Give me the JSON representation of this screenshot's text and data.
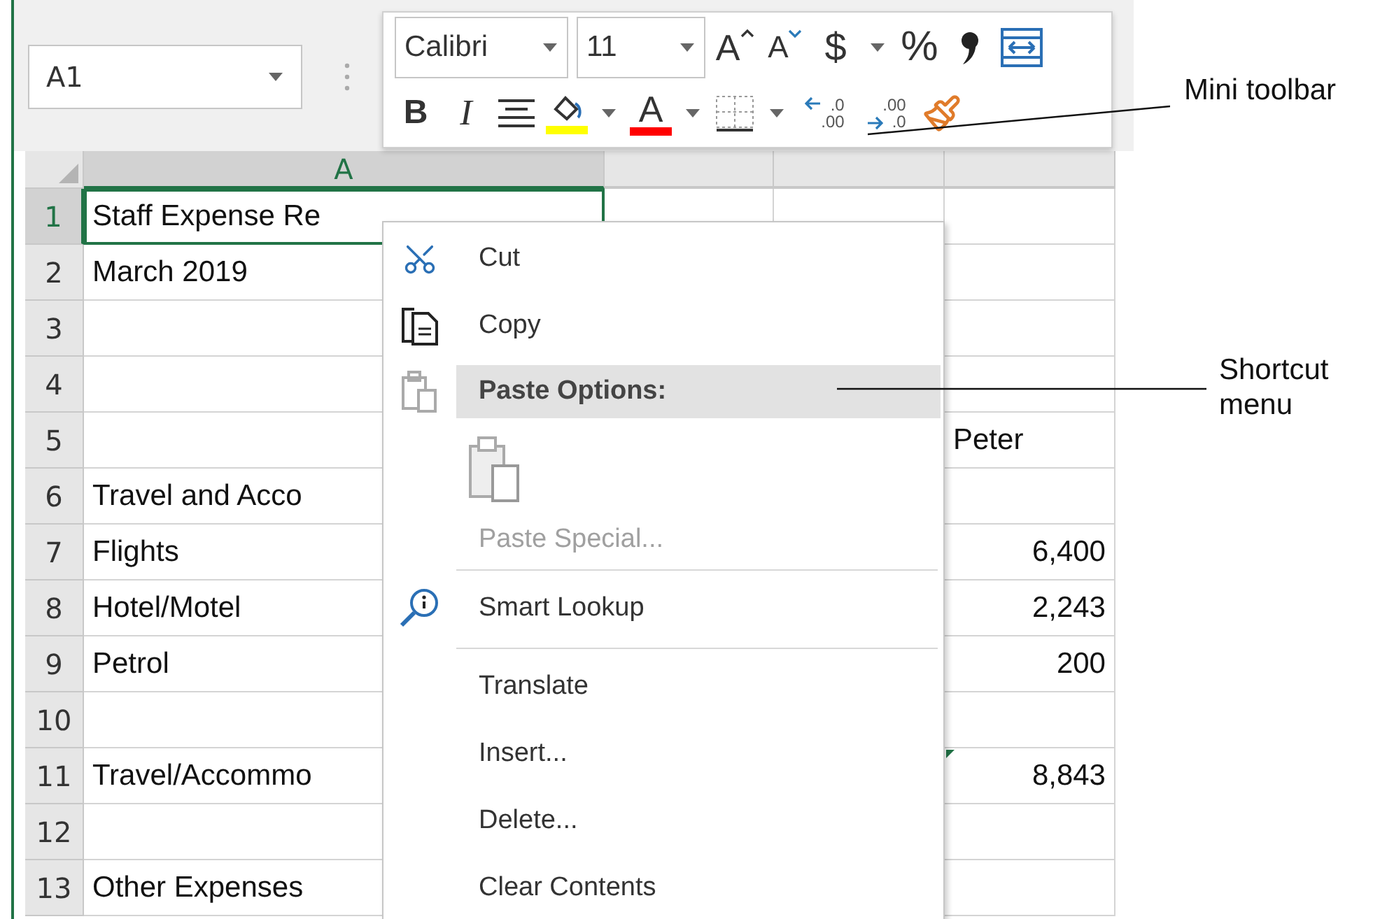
{
  "name_box": {
    "value": "A1"
  },
  "columns": [
    {
      "label": "A",
      "selected": true
    }
  ],
  "rows": [
    {
      "number": "1",
      "selected": true,
      "column_a": "Staff Expense Re"
    },
    {
      "number": "2",
      "selected": false,
      "column_a": "March 2019"
    },
    {
      "number": "3",
      "selected": false
    },
    {
      "number": "4",
      "selected": false
    },
    {
      "number": "5",
      "selected": false,
      "column_d": {
        "text": "Peter",
        "kind": "text"
      }
    },
    {
      "number": "6",
      "selected": false,
      "column_a": "Travel and Acco"
    },
    {
      "number": "7",
      "selected": false,
      "column_a": "Flights",
      "column_d": {
        "text": "6,400",
        "kind": "number"
      }
    },
    {
      "number": "8",
      "selected": false,
      "column_a": "Hotel/Motel",
      "column_d": {
        "text": "2,243",
        "kind": "number"
      }
    },
    {
      "number": "9",
      "selected": false,
      "column_a": "Petrol",
      "column_d": {
        "text": "200",
        "kind": "number"
      }
    },
    {
      "number": "10",
      "selected": false
    },
    {
      "number": "11",
      "selected": false,
      "column_a": "Travel/Accommo",
      "column_d": {
        "text": "8,843",
        "kind": "number",
        "error_flag": true
      }
    },
    {
      "number": "12",
      "selected": false
    },
    {
      "number": "13",
      "selected": false,
      "column_a": "Other Expenses"
    }
  ],
  "mini_toolbar": {
    "font": "Calibri",
    "size": "11",
    "row_1": [
      {
        "kind": "grow-font",
        "glyph": "A"
      },
      {
        "kind": "shrink-font",
        "glyph": "A"
      },
      {
        "kind": "currency",
        "glyph": "$"
      },
      {
        "kind": "caret"
      },
      {
        "kind": "percent",
        "glyph": "%"
      },
      {
        "kind": "comma"
      },
      {
        "kind": "wrap"
      }
    ],
    "row_2": [
      {
        "kind": "bold",
        "glyph": "B"
      },
      {
        "kind": "italic",
        "glyph": "I"
      },
      {
        "kind": "align"
      },
      {
        "kind": "fill"
      },
      {
        "kind": "caret"
      },
      {
        "kind": "font-color",
        "glyph": "A"
      },
      {
        "kind": "caret"
      },
      {
        "kind": "borders"
      },
      {
        "kind": "caret"
      },
      {
        "kind": "decimal-more",
        "top": ".0",
        "bottom": ".00"
      },
      {
        "kind": "decimal-less",
        "top": ".00",
        "bottom": ".0"
      },
      {
        "kind": "painter"
      }
    ]
  },
  "shortcut_menu": [
    {
      "kind": "command",
      "label": "Cut",
      "disabled": false
    },
    {
      "kind": "command",
      "label": "Copy",
      "disabled": false
    },
    {
      "kind": "header",
      "label": "Paste Options:"
    },
    {
      "kind": "paste-button"
    },
    {
      "kind": "command",
      "label": "Paste Special...",
      "disabled": true
    },
    {
      "kind": "separator"
    },
    {
      "kind": "command",
      "label": "Smart Lookup",
      "disabled": false
    },
    {
      "kind": "separator"
    },
    {
      "kind": "command",
      "label": "Translate",
      "disabled": false
    },
    {
      "kind": "command",
      "label": "Insert...",
      "disabled": false
    },
    {
      "kind": "command",
      "label": "Delete...",
      "disabled": false
    },
    {
      "kind": "command",
      "label": "Clear Contents",
      "disabled": false
    }
  ],
  "callouts": [
    {
      "label": "Mini toolbar"
    },
    {
      "label": "Shortcut menu"
    }
  ]
}
